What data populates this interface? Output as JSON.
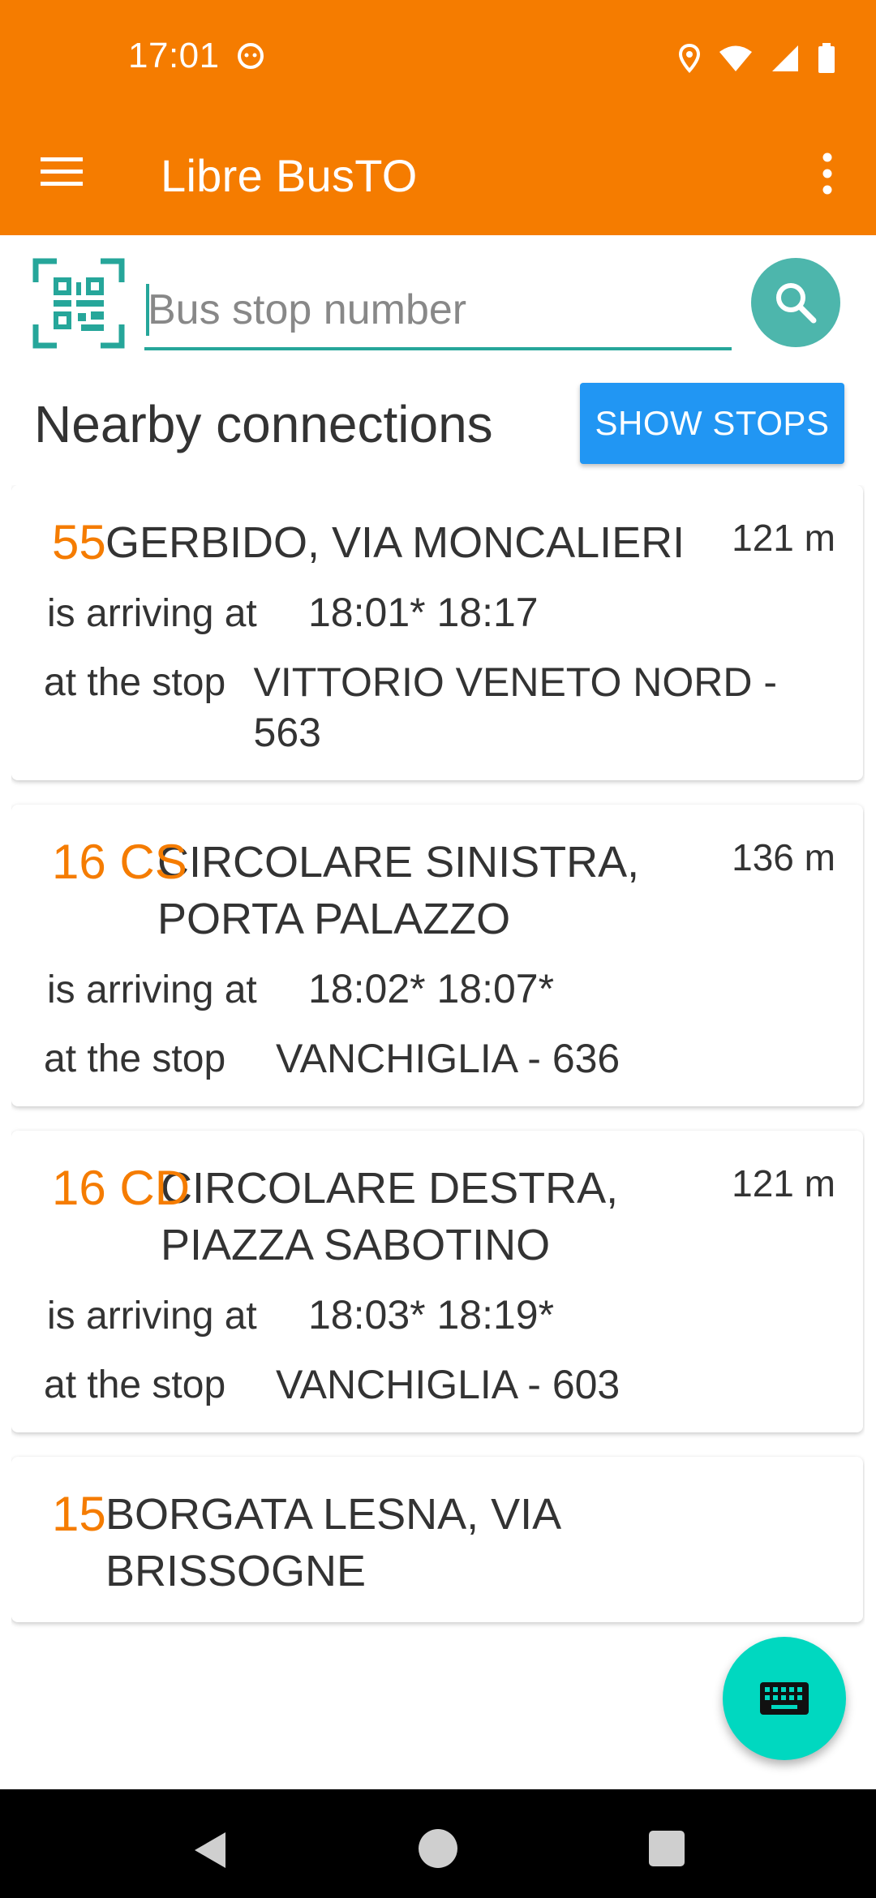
{
  "status_bar": {
    "time": "17:01"
  },
  "toolbar": {
    "title": "Libre BusTO"
  },
  "search": {
    "placeholder": "Bus stop number",
    "value": ""
  },
  "section": {
    "title": "Nearby connections",
    "show_stops_label": "SHOW STOPS"
  },
  "labels": {
    "arriving": "is arriving at",
    "at_stop": "at the stop"
  },
  "routes": [
    {
      "line": "55",
      "destination": "GERBIDO, VIA MONCALIERI",
      "distance": "121 m",
      "times": "18:01* 18:17",
      "stop": "VITTORIO VENETO NORD - 563"
    },
    {
      "line": "16 CS",
      "destination": "CIRCOLARE SINISTRA, PORTA PALAZZO",
      "distance": "136 m",
      "times": "18:02* 18:07*",
      "stop": "VANCHIGLIA - 636"
    },
    {
      "line": "16 CD",
      "destination": "CIRCOLARE DESTRA, PIAZZA SABOTINO",
      "distance": "121 m",
      "times": "18:03* 18:19*",
      "stop": "VANCHIGLIA - 603"
    },
    {
      "line": "15",
      "destination": "BORGATA LESNA, VIA BRISSOGNE",
      "distance": "",
      "times": "",
      "stop": ""
    }
  ],
  "colors": {
    "primary": "#F57C00",
    "accent": "#26A69A",
    "button": "#2196F3",
    "fab": "#00D8C0"
  },
  "icons": {
    "menu": "menu-icon",
    "overflow": "more-vert-icon",
    "qr": "qr-code-icon",
    "search": "search-icon",
    "fab": "keyboard-icon"
  }
}
